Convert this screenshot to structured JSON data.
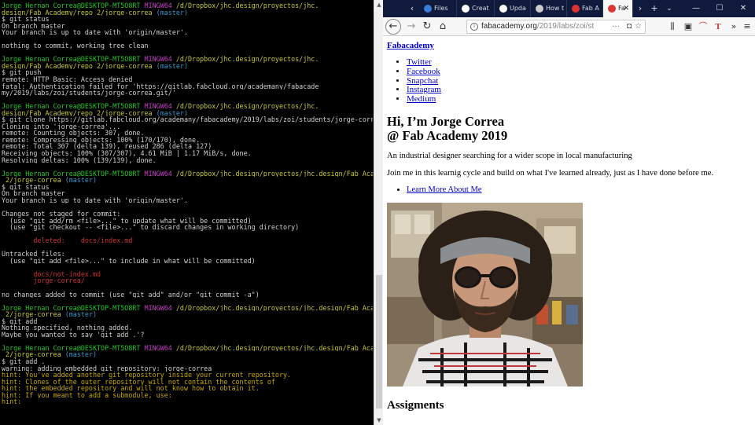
{
  "terminal": {
    "lines": [
      [
        {
          "t": "Jorge Hernan Correa@DESKTOP-MT5O8RT ",
          "c": "c-green"
        },
        {
          "t": "MINGW64 ",
          "c": "c-mag"
        },
        {
          "t": "/d/Dropbox/jhc.design/proyectos/jhc.",
          "c": "c-yel"
        }
      ],
      [
        {
          "t": "design/Fab Academy/repo 2/jorge-correa ",
          "c": "c-yel"
        },
        {
          "t": "(master)",
          "c": "c-cyan"
        }
      ],
      [
        {
          "t": "$ git status",
          "c": "c-wht"
        }
      ],
      [
        {
          "t": "On branch master",
          "c": "c-wht"
        }
      ],
      [
        {
          "t": "Your branch is up to date with 'origin/master'.",
          "c": "c-wht"
        }
      ],
      [
        {
          "t": "",
          "c": "c-wht"
        }
      ],
      [
        {
          "t": "nothing to commit, working tree clean",
          "c": "c-wht"
        }
      ],
      [
        {
          "t": "",
          "c": "c-wht"
        }
      ],
      [
        {
          "t": "Jorge Hernan Correa@DESKTOP-MT5O8RT ",
          "c": "c-green"
        },
        {
          "t": "MINGW64 ",
          "c": "c-mag"
        },
        {
          "t": "/d/Dropbox/jhc.design/proyectos/jhc.",
          "c": "c-yel"
        }
      ],
      [
        {
          "t": "design/Fab Academy/repo 2/jorge-correa ",
          "c": "c-yel"
        },
        {
          "t": "(master)",
          "c": "c-cyan"
        }
      ],
      [
        {
          "t": "$ git push",
          "c": "c-wht"
        }
      ],
      [
        {
          "t": "remote: HTTP Basic: Access denied",
          "c": "c-wht"
        }
      ],
      [
        {
          "t": "fatal: Authentication failed for 'https://gitlab.fabcloud.org/academany/fabacade",
          "c": "c-wht"
        }
      ],
      [
        {
          "t": "my/2019/labs/zoi/students/jorge-correa.git/'",
          "c": "c-wht"
        }
      ],
      [
        {
          "t": "",
          "c": "c-wht"
        }
      ],
      [
        {
          "t": "Jorge Hernan Correa@DESKTOP-MT5O8RT ",
          "c": "c-green"
        },
        {
          "t": "MINGW64 ",
          "c": "c-mag"
        },
        {
          "t": "/d/Dropbox/jhc.design/proyectos/jhc.",
          "c": "c-yel"
        }
      ],
      [
        {
          "t": "design/Fab Academy/repo 2/jorge-correa ",
          "c": "c-yel"
        },
        {
          "t": "(master)",
          "c": "c-cyan"
        }
      ],
      [
        {
          "t": "$ git clone https://gitlab.fabcloud.org/academany/fabacademy/2019/labs/zoi/students/jorge-correa.git",
          "c": "c-wht"
        }
      ],
      [
        {
          "t": "Cloning into 'jorge-correa'...",
          "c": "c-wht"
        }
      ],
      [
        {
          "t": "remote: Counting objects: 307, done.",
          "c": "c-wht"
        }
      ],
      [
        {
          "t": "remote: Compressing objects: 100% (170/170), done.",
          "c": "c-wht"
        }
      ],
      [
        {
          "t": "remote: Total 307 (delta 139), reused 286 (delta 127)",
          "c": "c-wht"
        }
      ],
      [
        {
          "t": "Receiving objects: 100% (307/307), 4.61 MiB | 1.17 MiB/s, done.",
          "c": "c-wht"
        }
      ],
      [
        {
          "t": "Resolving deltas: 100% (139/139), done.",
          "c": "c-wht"
        }
      ],
      [
        {
          "t": "",
          "c": "c-wht"
        }
      ],
      [
        {
          "t": "Jorge Hernan Correa@DESKTOP-MT5O8RT ",
          "c": "c-green"
        },
        {
          "t": "MINGW64 ",
          "c": "c-mag"
        },
        {
          "t": "/d/Dropbox/jhc.design/proyectos/jhc.design/Fab Academy/repo",
          "c": "c-yel"
        }
      ],
      [
        {
          "t": " 2/jorge-correa ",
          "c": "c-yel"
        },
        {
          "t": "(master)",
          "c": "c-cyan"
        }
      ],
      [
        {
          "t": "$ git status",
          "c": "c-wht"
        }
      ],
      [
        {
          "t": "On branch master",
          "c": "c-wht"
        }
      ],
      [
        {
          "t": "Your branch is up to date with 'origin/master'.",
          "c": "c-wht"
        }
      ],
      [
        {
          "t": "",
          "c": "c-wht"
        }
      ],
      [
        {
          "t": "Changes not staged for commit:",
          "c": "c-wht"
        }
      ],
      [
        {
          "t": "  (use \"git add/rm <file>...\" to update what will be committed)",
          "c": "c-wht"
        }
      ],
      [
        {
          "t": "  (use \"git checkout -- <file>...\" to discard changes in working directory)",
          "c": "c-wht"
        }
      ],
      [
        {
          "t": "",
          "c": "c-wht"
        }
      ],
      [
        {
          "t": "        deleted:    docs/index.md",
          "c": "c-red"
        }
      ],
      [
        {
          "t": "",
          "c": "c-wht"
        }
      ],
      [
        {
          "t": "Untracked files:",
          "c": "c-wht"
        }
      ],
      [
        {
          "t": "  (use \"git add <file>...\" to include in what will be committed)",
          "c": "c-wht"
        }
      ],
      [
        {
          "t": "",
          "c": "c-wht"
        }
      ],
      [
        {
          "t": "        docs/not-index.md",
          "c": "c-red"
        }
      ],
      [
        {
          "t": "        jorge-correa/",
          "c": "c-red"
        }
      ],
      [
        {
          "t": "",
          "c": "c-wht"
        }
      ],
      [
        {
          "t": "no changes added to commit (use \"git add\" and/or \"git commit -a\")",
          "c": "c-wht"
        }
      ],
      [
        {
          "t": "",
          "c": "c-wht"
        }
      ],
      [
        {
          "t": "Jorge Hernan Correa@DESKTOP-MT5O8RT ",
          "c": "c-green"
        },
        {
          "t": "MINGW64 ",
          "c": "c-mag"
        },
        {
          "t": "/d/Dropbox/jhc.design/proyectos/jhc.design/Fab Academy/repo",
          "c": "c-yel"
        }
      ],
      [
        {
          "t": " 2/jorge-correa ",
          "c": "c-yel"
        },
        {
          "t": "(master)",
          "c": "c-cyan"
        }
      ],
      [
        {
          "t": "$ git add",
          "c": "c-wht"
        }
      ],
      [
        {
          "t": "Nothing specified, nothing added.",
          "c": "c-wht"
        }
      ],
      [
        {
          "t": "Maybe you wanted to say 'git add .'?",
          "c": "c-wht"
        }
      ],
      [
        {
          "t": "",
          "c": "c-wht"
        }
      ],
      [
        {
          "t": "Jorge Hernan Correa@DESKTOP-MT5O8RT ",
          "c": "c-green"
        },
        {
          "t": "MINGW64 ",
          "c": "c-mag"
        },
        {
          "t": "/d/Dropbox/jhc.design/proyectos/jhc.design/Fab Academy/repo",
          "c": "c-yel"
        }
      ],
      [
        {
          "t": " 2/jorge-correa ",
          "c": "c-yel"
        },
        {
          "t": "(master)",
          "c": "c-cyan"
        }
      ],
      [
        {
          "t": "$ git add .",
          "c": "c-wht"
        }
      ],
      [
        {
          "t": "warning: adding embedded git repository: jorge-correa",
          "c": "c-wht"
        }
      ],
      [
        {
          "t": "hint: You've added another git repository inside your current repository.",
          "c": "c-hint"
        }
      ],
      [
        {
          "t": "hint: Clones of the outer repository will not contain the contents of",
          "c": "c-hint"
        }
      ],
      [
        {
          "t": "hint: the embedded repository and will not know how to obtain it.",
          "c": "c-hint"
        }
      ],
      [
        {
          "t": "hint: If you meant to add a submodule, use:",
          "c": "c-hint"
        }
      ],
      [
        {
          "t": "hint:",
          "c": "c-hint"
        }
      ]
    ]
  },
  "browser": {
    "tabs": [
      {
        "label": "Files",
        "icon": "files-icon",
        "icon_color": "#3a7bd5",
        "active": false
      },
      {
        "label": "Creat",
        "icon": "github-icon",
        "icon_color": "#ffffff",
        "active": false
      },
      {
        "label": "Upda",
        "icon": "github-icon",
        "icon_color": "#ffffff",
        "active": false
      },
      {
        "label": "How t",
        "icon": "page-icon",
        "icon_color": "#cccccc",
        "active": false
      },
      {
        "label": "Fab A",
        "icon": "fab-icon",
        "icon_color": "#d33",
        "active": false
      },
      {
        "label": "Fa",
        "icon": "fab-icon",
        "icon_color": "#d33",
        "active": true
      }
    ],
    "tab_close_glyph": "✕",
    "new_tab_glyph": "+",
    "url_main": "fabacademy.org",
    "url_rest": "/2019/labs/zoi/st",
    "url_more": "···"
  },
  "page": {
    "site_title": "Fabacademy",
    "social_links": [
      "Twitter",
      "Facebook",
      "Snapchat",
      "Instagram",
      "Medium"
    ],
    "hero_line1": "Hi, I’m Jorge Correa",
    "hero_line2": "@ Fab Academy 2019",
    "intro": "An industrial designer searching for a wider scope in local manufacturing",
    "join": "Join me in this learnig cycle and build on what I've learned already, just as I have done before me.",
    "about_link": "Learn More About Me",
    "section_title": "Assigments"
  }
}
